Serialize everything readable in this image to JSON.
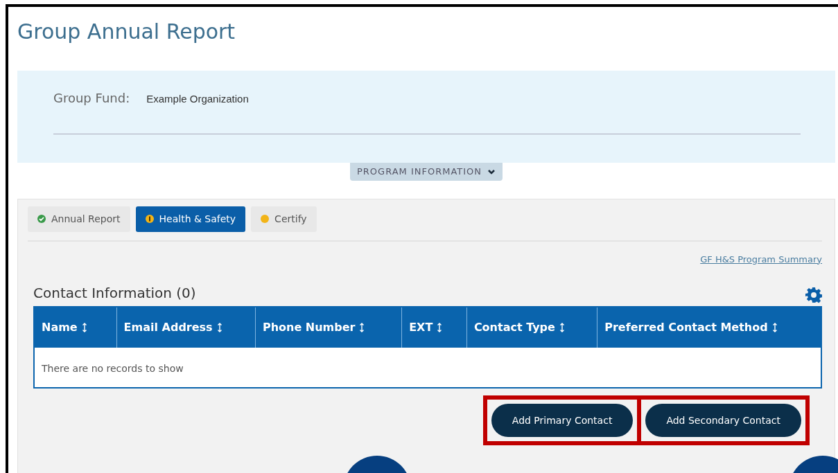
{
  "page_title": "Group Annual Report",
  "group_fund": {
    "label": "Group Fund:",
    "value": "Example Organization"
  },
  "program_toggle": {
    "label": "PROGRAM INFORMATION",
    "expanded": false
  },
  "tabs": [
    {
      "label": "Annual Report",
      "kind": "complete",
      "selected": false
    },
    {
      "label": "Health & Safety",
      "kind": "alert",
      "selected": true
    },
    {
      "label": "Certify",
      "kind": "pending",
      "selected": false
    }
  ],
  "summary_link": "GF H&S Program Summary",
  "section_title": "Contact Information (0)",
  "table": {
    "columns": [
      "Name",
      "Email Address",
      "Phone Number",
      "EXT",
      "Contact Type",
      "Preferred Contact Method"
    ],
    "empty_message": "There are no records to show"
  },
  "buttons": [
    {
      "label": "Add Primary Contact",
      "highlighted": true,
      "callout": true
    },
    {
      "label": "Add Secondary Contact",
      "highlighted": true,
      "callout": true
    }
  ]
}
